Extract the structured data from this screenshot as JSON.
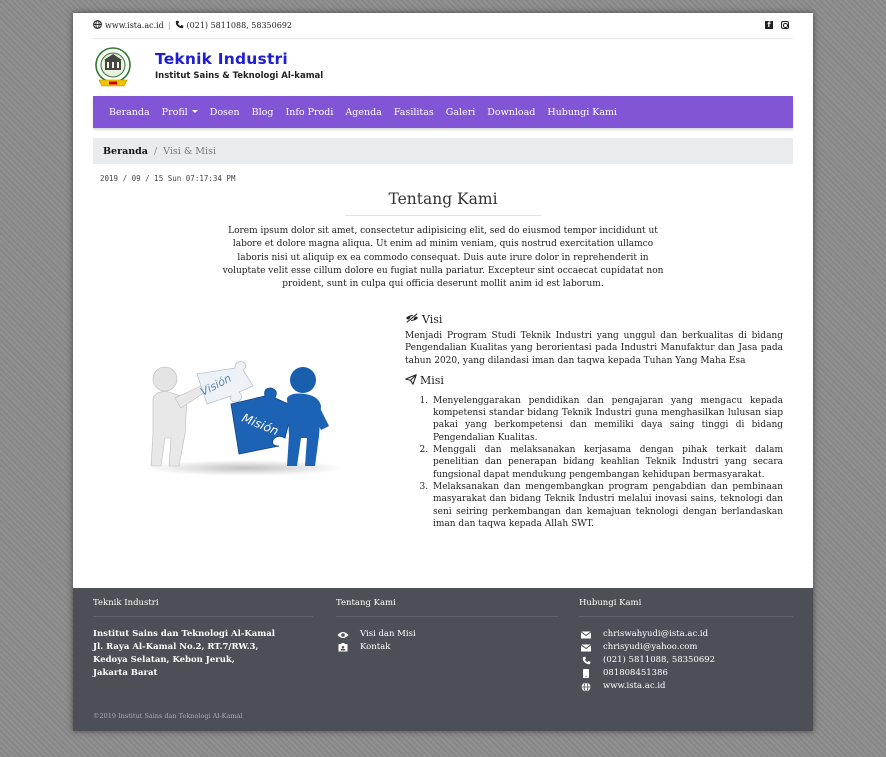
{
  "topbar": {
    "website": "www.ista.ac.id",
    "separator": "|",
    "phone": "(021) 5811088, 58350692",
    "social": [
      "facebook-icon",
      "instagram-icon"
    ]
  },
  "brand": {
    "title": "Teknik Industri",
    "subtitle": "Institut Sains & Teknologi Al-kamal"
  },
  "nav": {
    "items": [
      "Beranda",
      "Profil",
      "Dosen",
      "Blog",
      "Info Prodi",
      "Agenda",
      "Fasilitas",
      "Galeri",
      "Download",
      "Hubungi Kami"
    ],
    "accent": "#8254d6"
  },
  "breadcrumb": {
    "home": "Beranda",
    "divider": "/",
    "current": "Visi & Misi"
  },
  "datetime": "2019 / 09 / 15 Sun 07:17:34 PM",
  "about": {
    "title": "Tentang Kami",
    "text": "Lorem ipsum dolor sit amet, consectetur adipisicing elit, sed do eiusmod tempor incididunt ut labore et dolore magna aliqua. Ut enim ad minim veniam, quis nostrud exercitation ullamco laboris nisi ut aliquip ex ea commodo consequat. Duis aute irure dolor in reprehenderit in voluptate velit esse cillum dolore eu fugiat nulla pariatur. Excepteur sint occaecat cupidatat non proident, sunt in culpa qui officia deserunt mollit anim id est laborum."
  },
  "illustration": {
    "left_piece": "Visión",
    "right_piece": "Misión"
  },
  "visi": {
    "heading": "Visi",
    "text": "Menjadi Program Studi Teknik Industri yang unggul dan berkualitas di bidang Pengendalian Kualitas yang berorientasi pada Industri Manufaktur dan Jasa pada tahun 2020, yang dilandasi iman dan taqwa kepada Tuhan Yang Maha Esa"
  },
  "misi": {
    "heading": "Misi",
    "items": [
      "Menyelenggarakan pendidikan dan pengajaran yang mengacu kepada kompetensi standar bidang Teknik Industri guna menghasilkan lulusan siap pakai yang berkompetensi dan memiliki daya saing tinggi di bidang Pengendalian Kualitas.",
      "Menggali dan melaksanakan kerjasama dengan pihak terkait dalam penelitian dan penerapan bidang keahlian Teknik Industri yang secara fungsional dapat mendukung pengembangan kehidupan bermasyarakat.",
      "Melaksanakan dan mengembangkan program pengabdian dan pembinaan masyarakat dan bidang Teknik Industri melalui inovasi sains, teknologi dan seni seiring perkembangan dan kemajuan teknologi dengan berlandaskan iman dan taqwa kepada Allah SWT."
    ]
  },
  "footer": {
    "col1_title": "Teknik Industri",
    "address": [
      "Institut Sains dan Teknologi Al-Kamal",
      "Jl. Raya Al-Kamal No.2, RT.7/RW.3,",
      "Kedoya Selatan, Kebon Jeruk,",
      "Jakarta Barat"
    ],
    "col2_title": "Tentang Kami",
    "links": [
      "Visi dan Misi",
      "Kontak"
    ],
    "col3_title": "Hubungi Kami",
    "contacts": [
      "chriswahyudi@ista.ac.id",
      "chrisyudi@yahoo.com",
      "(021) 5811088, 58350692",
      "081808451386",
      "www.ista.ac.id"
    ],
    "copyright": "©2019 Institut Sains dan Teknologi Al-Kamal"
  }
}
